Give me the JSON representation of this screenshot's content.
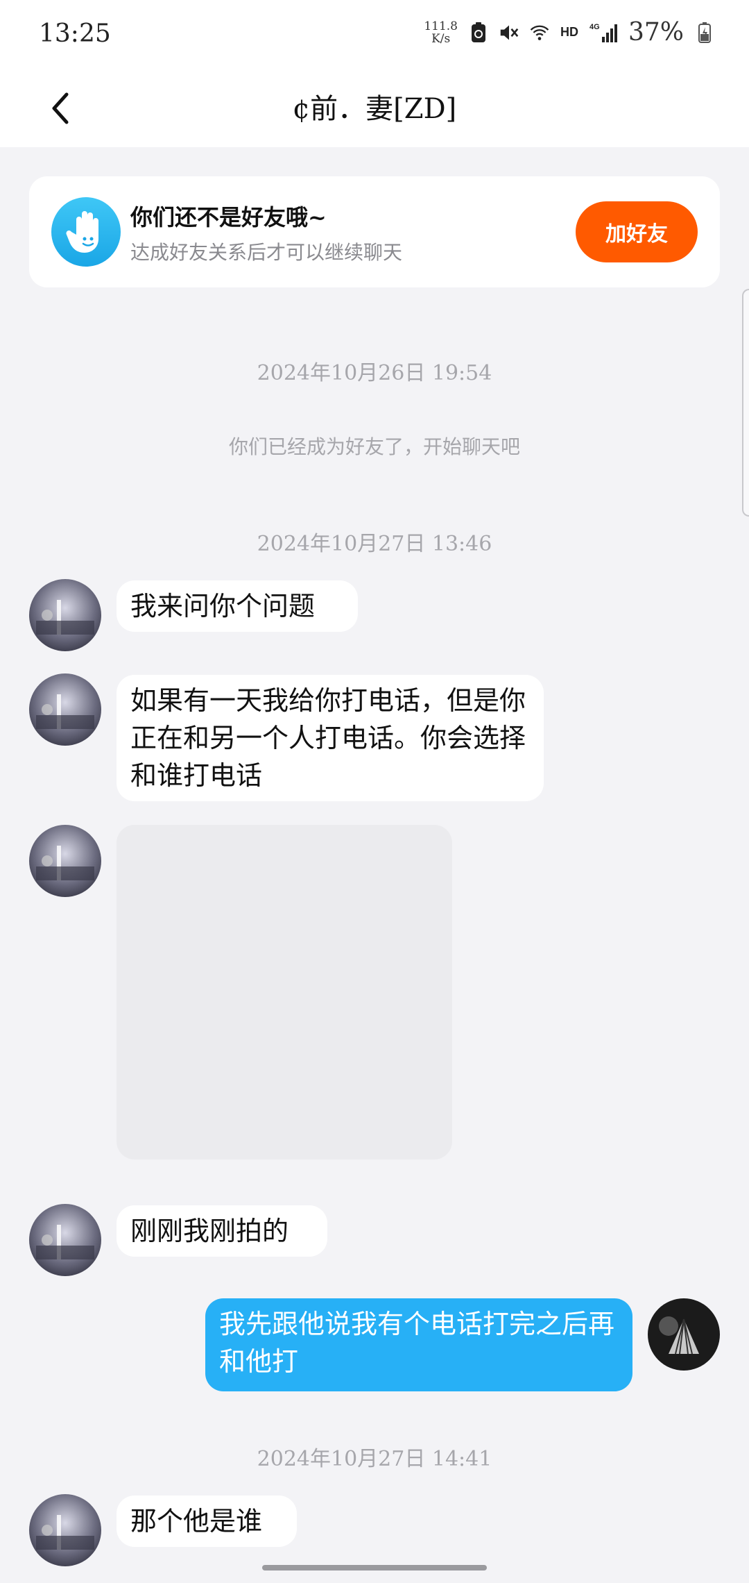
{
  "status_bar": {
    "time": "13:25",
    "speed_value": "111.8",
    "speed_unit": "K/s",
    "network": "HD",
    "signal": "4G",
    "battery": "37%",
    "icons": [
      "battery-saver-icon",
      "mute-icon",
      "wifi-icon",
      "signal-icon",
      "battery-icon"
    ]
  },
  "header": {
    "back_icon": "chevron-left-icon",
    "title": "¢前．妻[ZD]"
  },
  "friend_notice": {
    "icon": "hand-wave-icon",
    "title": "你们还不是好友哦~",
    "subtitle": "达成好友关系后才可以继续聊天",
    "button": "加好友",
    "button_color": "#ff5a00"
  },
  "chat": {
    "timestamps": [
      "2024年10月26日  19:54",
      "2024年10月27日  13:46",
      "2024年10月27日  14:41"
    ],
    "system_message": "你们已经成为好友了，开始聊天吧",
    "messages": [
      {
        "from": "other",
        "text": "我来问你个问题"
      },
      {
        "from": "other",
        "text": "如果有一天我给你打电话，但是你正在和另一个人打电话。你会选择和谁打电话"
      },
      {
        "from": "other",
        "type": "image"
      },
      {
        "from": "other",
        "text": "刚刚我刚拍的"
      },
      {
        "from": "me",
        "text": "我先跟他说我有个电话打完之后再和他打"
      },
      {
        "from": "other",
        "text": "那个他是谁"
      }
    ],
    "my_bubble_color": "#27b0f6"
  }
}
